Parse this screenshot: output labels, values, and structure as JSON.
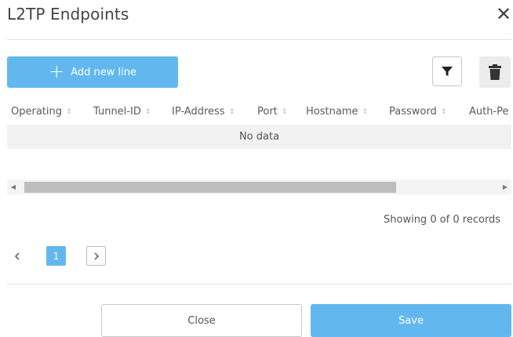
{
  "dialog": {
    "title": "L2TP Endpoints",
    "close_glyph": "✕"
  },
  "toolbar": {
    "add_label": "Add new line",
    "add_icon": "plus-icon",
    "filter_icon": "filter-icon",
    "delete_icon": "trash-icon"
  },
  "table": {
    "columns": [
      "Operating",
      "Tunnel-ID",
      "IP-Address",
      "Port",
      "Hostname",
      "Password",
      "Auth-Pe"
    ],
    "empty_text": "No data"
  },
  "footer": {
    "records_text": "Showing 0 of 0 records",
    "current_page": "1"
  },
  "actions": {
    "close_label": "Close",
    "save_label": "Save"
  },
  "colors": {
    "accent": "#62b8ee",
    "button_gray": "#ececec"
  }
}
